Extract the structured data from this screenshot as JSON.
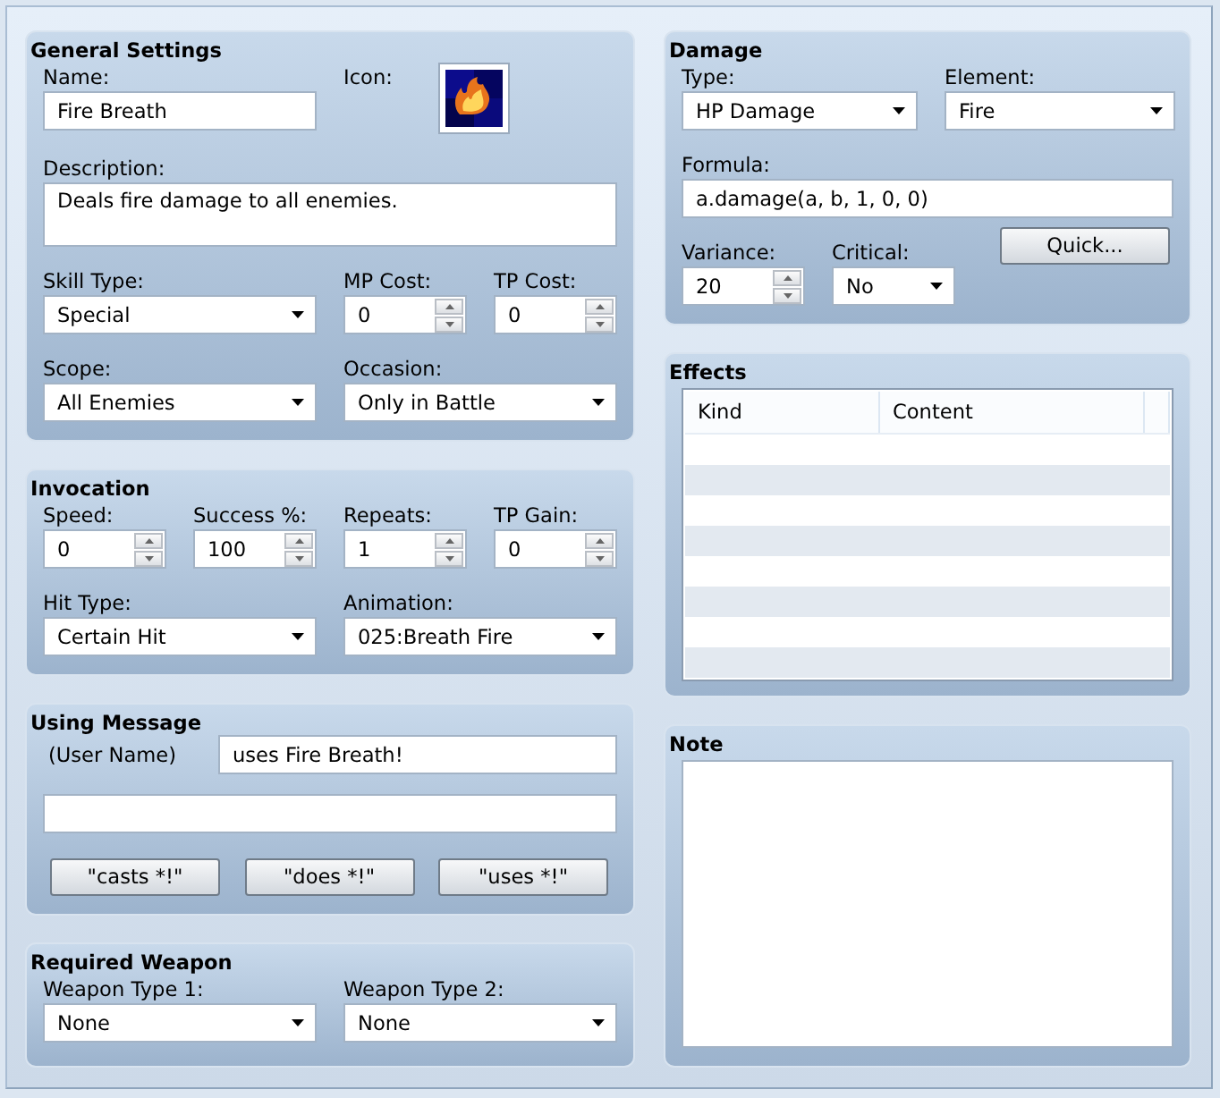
{
  "general_settings": {
    "title": "General Settings",
    "fields": [
      {
        "kind": "text",
        "label": "Name:",
        "value": "Fire Breath"
      },
      {
        "kind": "icon",
        "label": "Icon:"
      },
      {
        "kind": "textarea",
        "label": "Description:",
        "value": "Deals fire damage to all enemies."
      },
      {
        "kind": "select",
        "label": "Skill Type:",
        "value": "Special"
      },
      {
        "kind": "spin",
        "label": "MP Cost:",
        "value": "0"
      },
      {
        "kind": "spin",
        "label": "TP Cost:",
        "value": "0"
      },
      {
        "kind": "select",
        "label": "Scope:",
        "value": "All Enemies"
      },
      {
        "kind": "select",
        "label": "Occasion:",
        "value": "Only in Battle"
      }
    ]
  },
  "invocation": {
    "title": "Invocation",
    "fields": [
      {
        "kind": "spin",
        "label": "Speed:",
        "value": "0"
      },
      {
        "kind": "spin",
        "label": "Success %:",
        "value": "100"
      },
      {
        "kind": "spin",
        "label": "Repeats:",
        "value": "1"
      },
      {
        "kind": "spin",
        "label": "TP Gain:",
        "value": "0"
      },
      {
        "kind": "select",
        "label": "Hit Type:",
        "value": "Certain Hit"
      },
      {
        "kind": "select",
        "label": "Animation:",
        "value": "025:Breath Fire"
      }
    ]
  },
  "using_message": {
    "title": "Using Message",
    "user_name": "(User Name)",
    "line_1": "uses Fire Breath!",
    "buttons": [
      "\"casts *!\"",
      "\"does *!\"",
      "\"uses *!\""
    ]
  },
  "required_weapon": {
    "title": "Required Weapon",
    "fields": [
      {
        "kind": "select",
        "label": "Weapon Type 1:",
        "value": "None"
      },
      {
        "kind": "select",
        "label": "Weapon Type 2:",
        "value": "None"
      }
    ]
  },
  "damage": {
    "title": "Damage",
    "type": {
      "label": "Type:",
      "value": "HP Damage"
    },
    "element": {
      "label": "Element:",
      "value": "Fire"
    },
    "formula": {
      "label": "Formula:",
      "value": "a.damage(a, b, 1, 0, 0)"
    },
    "variance": {
      "label": "Variance:",
      "value": "20"
    },
    "critical": {
      "label": "Critical:",
      "value": "No"
    },
    "quick_button": "Quick..."
  },
  "effects": {
    "title": "Effects",
    "columns": [
      "Kind",
      "Content"
    ]
  },
  "note": {
    "title": "Note"
  }
}
